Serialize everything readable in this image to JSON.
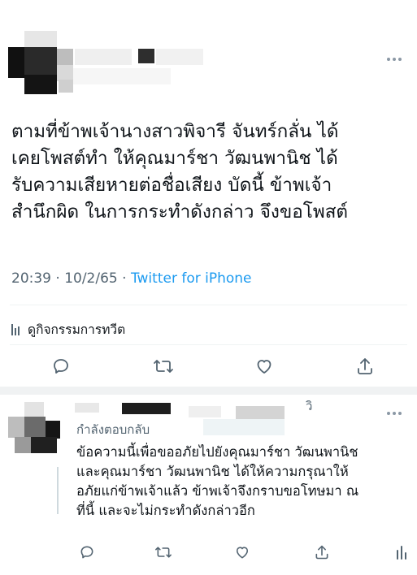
{
  "tweet": {
    "more_icon": "more-horizontal-icon",
    "text_lines": [
      "ตามที่ข้าพเจ้านางสาวพิจารี จันทร์กลั่น ได้",
      "เคยโพสต์ทำ ให้คุณมาร์ชา วัฒนพานิช ได้",
      "รับความเสียหายต่อชื่อเสียง บัดนี้ ข้าพเจ้า",
      "สำนึกผิด ในการกระทำดังกล่าว จึงขอโพสต์"
    ],
    "timestamp": "20:39 · 10/2/65 · ",
    "source": "Twitter for iPhone",
    "activity_label": "ดูกิจกรรมการทวีต",
    "actions": [
      "reply-icon",
      "retweet-icon",
      "like-icon",
      "share-icon"
    ],
    "colors": {
      "text": "#0f1419",
      "meta": "#536471",
      "link": "#1d9bf0",
      "icon": "#536471"
    }
  },
  "reply": {
    "name_fragment": "วิ",
    "replying_to": "กำลังตอบกลับ",
    "text_lines": [
      "ข้อความนี้เพื่อขออภัยไปยังคุณมาร์ชา วัฒนพานิช",
      "และคุณมาร์ชา วัฒนพานิช ได้ให้ความกรุณาให้",
      "อภัยแก่ข้าพเจ้าแล้ว ข้าพเจ้าจึงกราบขอโทษมา ณ",
      "ที่นี้ และจะไม่กระทำดังกล่าวอีก"
    ],
    "actions": [
      "reply-icon",
      "retweet-icon",
      "like-icon",
      "share-icon",
      "analytics-icon"
    ]
  }
}
